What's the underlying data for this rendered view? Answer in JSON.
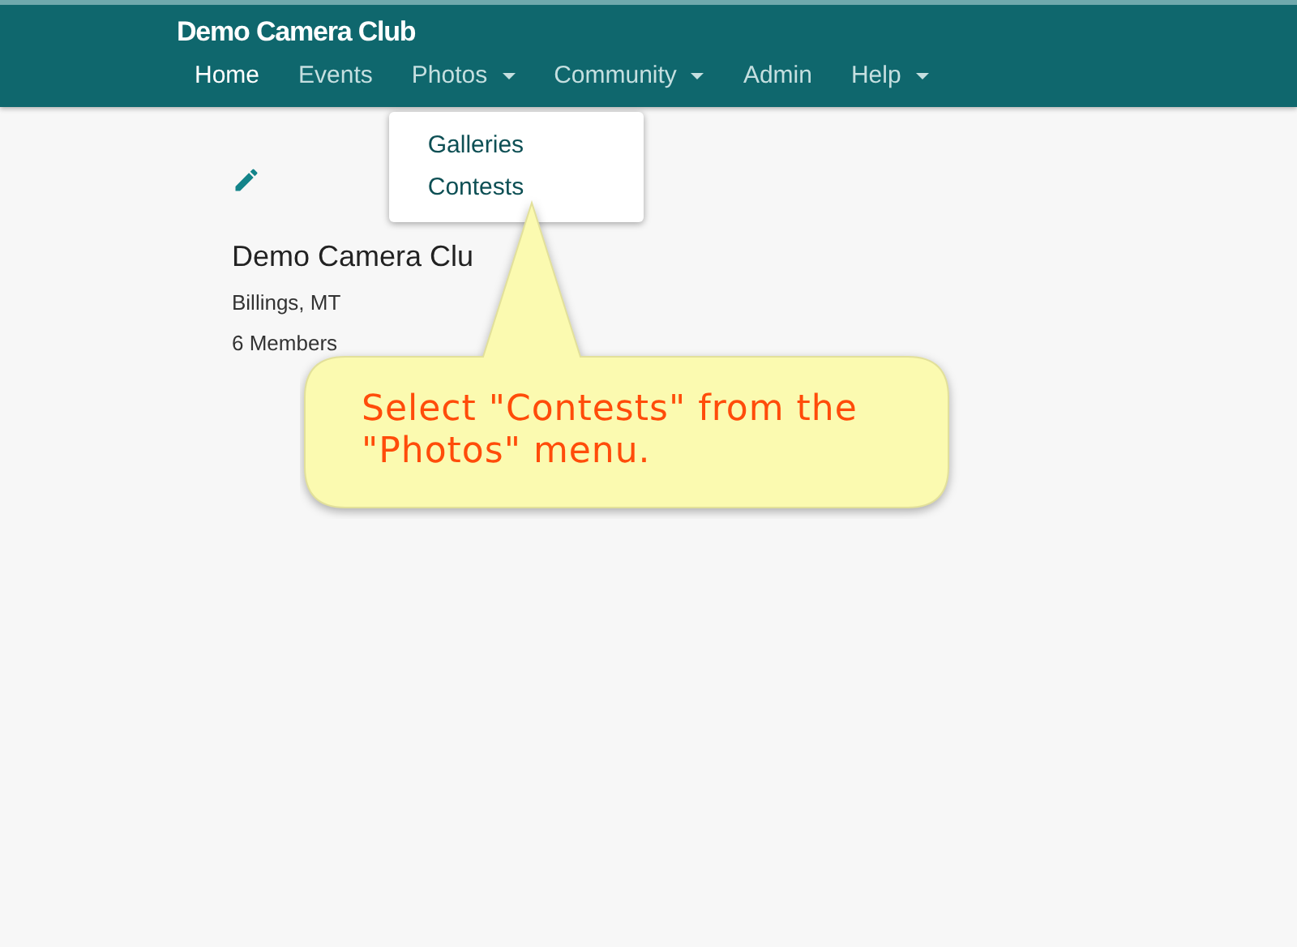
{
  "navbar": {
    "brand": "Demo Camera Club",
    "items": [
      {
        "label": "Home",
        "kind": "link",
        "selected": true
      },
      {
        "label": "Events",
        "kind": "link",
        "selected": false
      },
      {
        "label": "Photos",
        "kind": "dropdown",
        "selected": false,
        "menu": [
          "Galleries",
          "Contests"
        ]
      },
      {
        "label": "Community",
        "kind": "dropdown",
        "selected": false
      },
      {
        "label": "Admin",
        "kind": "link",
        "selected": false
      },
      {
        "label": "Help",
        "kind": "dropdown",
        "selected": false
      }
    ]
  },
  "club": {
    "name": "Demo Camera Clu",
    "location": "Billings, MT",
    "members": "6 Members"
  },
  "callout": {
    "text": "Select \"Contests\" from the \"Photos\" menu."
  }
}
